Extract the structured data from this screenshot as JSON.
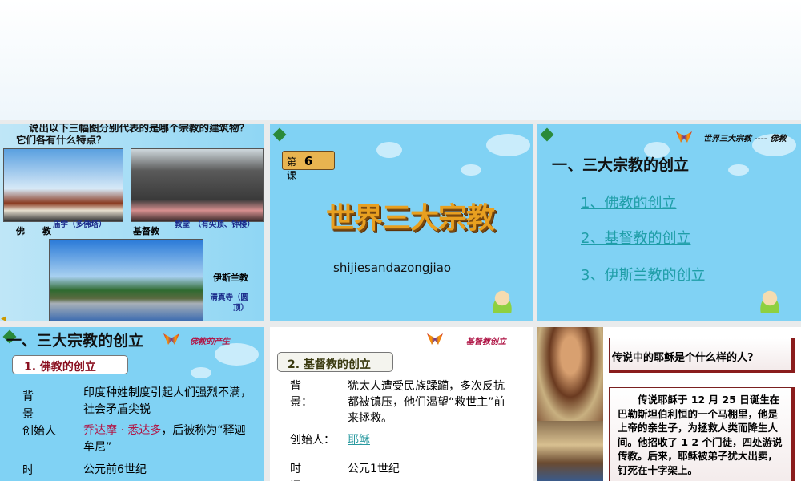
{
  "slide1": {
    "question": "说出以下三幅图分别代表的是哪个宗教的建筑物？它们各有什么特点？",
    "buddhism": "佛　　教",
    "buddhism_building": "庙宇（多佛塔）",
    "christianity": "基督教",
    "christianity_building": "教堂　（有尖顶、钟楼）",
    "islam": "伊斯兰教",
    "islam_building": "清真寺（圆顶）"
  },
  "slide2": {
    "lesson_prefix": "第",
    "lesson_number": "6",
    "lesson_suffix": "课",
    "title": "世界三大宗教",
    "pinyin": "shijiesandazongjiao"
  },
  "slide3": {
    "header": "世界三大宗教 ---- 佛教",
    "heading": "一、三大宗教的创立",
    "links": [
      "1、佛教的创立",
      "2、基督教的创立",
      "3、伊斯兰教的创立"
    ]
  },
  "slide4": {
    "heading": "一、三大宗教的创立",
    "tag": "佛教的产生",
    "box": "1. 佛教的创立",
    "rows": [
      {
        "label": "背景",
        "value": "印度种姓制度引起人们强烈不满，社会矛盾尖锐"
      },
      {
        "label": "创始人",
        "value_red": "乔达摩 · 悉达多",
        "value": "，后被称为“释迦牟尼”"
      },
      {
        "label": "时间",
        "value": "公元前6世纪"
      }
    ]
  },
  "slide5": {
    "tag": "基督教创立",
    "box": "2. 基督教的创立",
    "rows": [
      {
        "label": "背景：",
        "value": "犹太人遭受民族蹂躏，多次反抗都被镇压，他们渴望“救世主”前来拯救。"
      },
      {
        "label": "创始人：",
        "value": "耶稣"
      },
      {
        "label": "时间",
        "value": "公元1世纪"
      }
    ]
  },
  "slide6": {
    "question": "传说中的耶稣是个什么样的人?",
    "story": "　　传说耶稣于 12 月 25 日诞生在巴勒斯坦伯利恒的一个马棚里，他是上帝的亲生子，为拯救人类而降生人间。他招收了 1 2 个门徒，四处游说传教。后来，耶稣被弟子犹大出卖，钉死在十字架上。"
  }
}
